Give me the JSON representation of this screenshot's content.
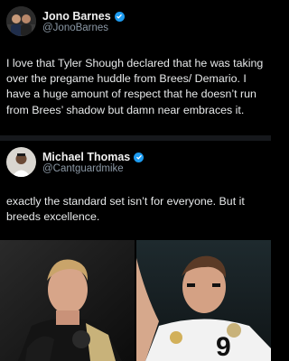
{
  "tweets": [
    {
      "name": "Jono Barnes",
      "handle": "@JonoBarnes",
      "text": "I love that Tyler Shough declared that he was taking over the pregame huddle from Brees/ Demario. I have a huge amount of respect that he doesn’t run from Brees’ shadow but damn near embraces it."
    },
    {
      "name": "Michael Thomas",
      "handle": "@Cantguardmike",
      "text": "exactly the standard set isn’t for everyone. But it breeds excellence."
    }
  ],
  "icons": {
    "verified": "verified-badge-icon"
  },
  "colors": {
    "background": "#000000",
    "text": "#e7e9ea",
    "secondary_text": "#8b98a5",
    "verified": "#1d9bf0"
  }
}
